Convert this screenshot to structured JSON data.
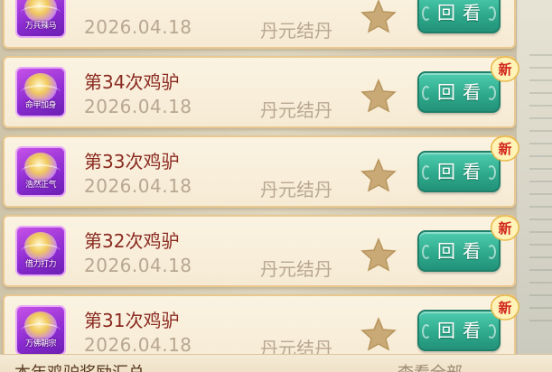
{
  "records": [
    {
      "title": "",
      "date": "2026.04.18",
      "category": "丹元结丹",
      "badge": "万兵辣马",
      "replay_label": "回看",
      "is_new": false
    },
    {
      "title": "第34次鸡驴",
      "date": "2026.04.18",
      "category": "丹元结丹",
      "badge": "命甲加身",
      "replay_label": "回看",
      "is_new": true
    },
    {
      "title": "第33次鸡驴",
      "date": "2026.04.18",
      "category": "丹元结丹",
      "badge": "浩然正气",
      "replay_label": "回看",
      "is_new": true
    },
    {
      "title": "第32次鸡驴",
      "date": "2026.04.18",
      "category": "丹元结丹",
      "badge": "借力打力",
      "replay_label": "回看",
      "is_new": true
    },
    {
      "title": "第31次鸡驴",
      "date": "2026.04.18",
      "category": "丹元结丹",
      "badge": "万佛朝宗",
      "replay_label": "回看",
      "is_new": true
    }
  ],
  "new_tag_label": "新",
  "footer": {
    "summary_title": "本年鸡驴奖励汇总",
    "view_all_label": "查看全部"
  },
  "colors": {
    "title": "#8a2a20",
    "date": "#b8a791",
    "button": "#2faa8c",
    "badge": "#8a2bd0",
    "star": "#c9aa77",
    "new_tag": "#d0241a"
  }
}
